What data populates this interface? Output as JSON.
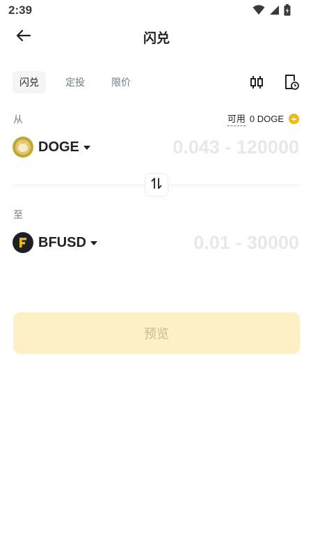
{
  "status_bar": {
    "time": "2:39"
  },
  "header": {
    "title": "闪兑"
  },
  "tabs": [
    {
      "label": "闪兑",
      "active": true
    },
    {
      "label": "定投",
      "active": false
    },
    {
      "label": "限价",
      "active": false
    }
  ],
  "from": {
    "label": "从",
    "available_label": "可用",
    "available_value": "0 DOGE",
    "coin": "DOGE",
    "amount_placeholder": "0.043 - 120000"
  },
  "to": {
    "label": "至",
    "coin": "BFUSD",
    "amount_placeholder": "0.01 - 30000"
  },
  "preview_button": {
    "label": "预览"
  },
  "icons": {
    "back": "arrow-left-icon",
    "chart": "candlestick-chart-icon",
    "history": "order-history-icon",
    "swap": "swap-vertical-icon",
    "add": "plus-circle-icon"
  },
  "colors": {
    "accent": "#f0b90b",
    "preview_button_bg": "#fdf0c4",
    "doge": "#c2a633",
    "bfusd_bg": "#1e2026",
    "bfusd_mark": "#f0b90b"
  }
}
